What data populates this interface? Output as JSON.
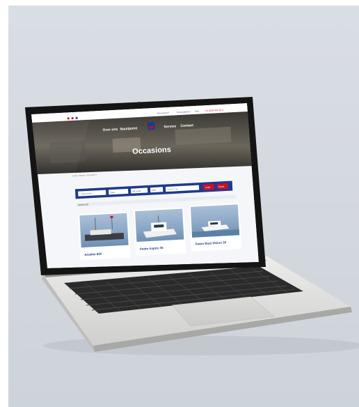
{
  "scene": {
    "kind": "laptop-mockup",
    "background_color": "#d6dbe1",
    "laptop_color": "#e6e6e4"
  },
  "website": {
    "top_links": [
      "Nieuwsbrief",
      "Verkoopboten",
      "Taal",
      "+31 (0)35 602 02 0"
    ],
    "nav_items": [
      "Over ons",
      "Nautipoint",
      "Service",
      "Contact"
    ],
    "hero_title": "Occasions",
    "breadcrumb": "Home / Boten / Occasions",
    "filter_bar": {
      "fields": [
        "-- Kies merk --",
        "Type",
        "Min prijs",
        "Max",
        "Zoeken op..."
      ],
      "buttons": [
        "Zoek",
        "Reset"
      ],
      "color": "#1f3a8a"
    },
    "results_label": "Aanbod (3)",
    "boats": [
      {
        "name": "Ariadne 820"
      },
      {
        "name": "Pedro Aspiro 35"
      },
      {
        "name": "Pedro Boat Skiron 35"
      }
    ],
    "accent_color": "#c8102e"
  }
}
